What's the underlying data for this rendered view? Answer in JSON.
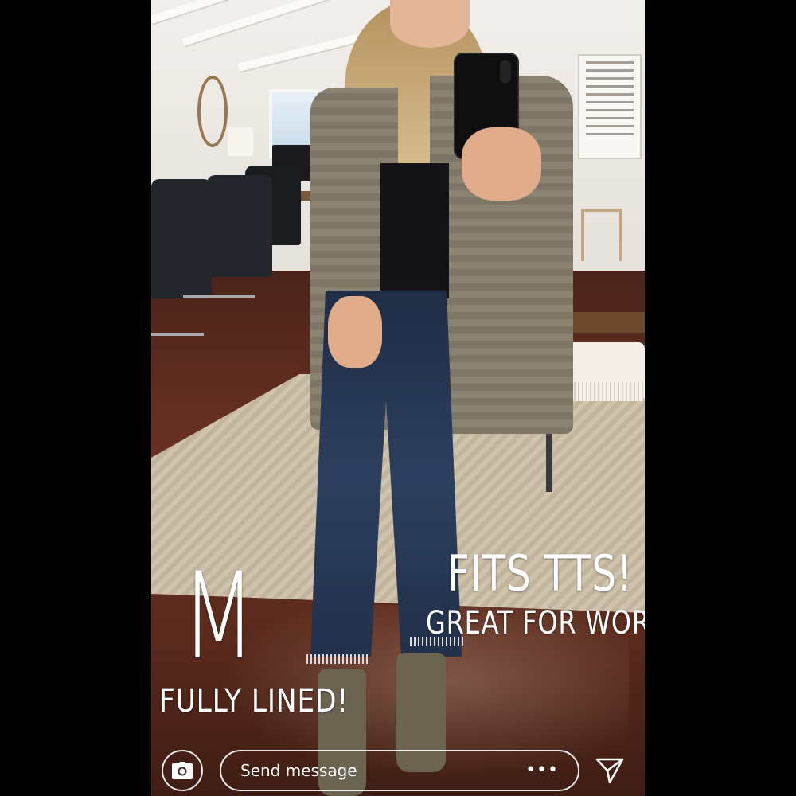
{
  "story": {
    "overlays": {
      "size": "M",
      "lined": "FULLY LINED!",
      "fit": "FITS TTS!",
      "work": "GREAT FOR WORK!"
    }
  },
  "reply_bar": {
    "camera_icon": "camera-icon",
    "message_placeholder": "Send message",
    "more_label": "•••",
    "send_icon": "send-icon"
  },
  "colors": {
    "overlay_text": "#ffffff",
    "letterbox": "#000000"
  }
}
